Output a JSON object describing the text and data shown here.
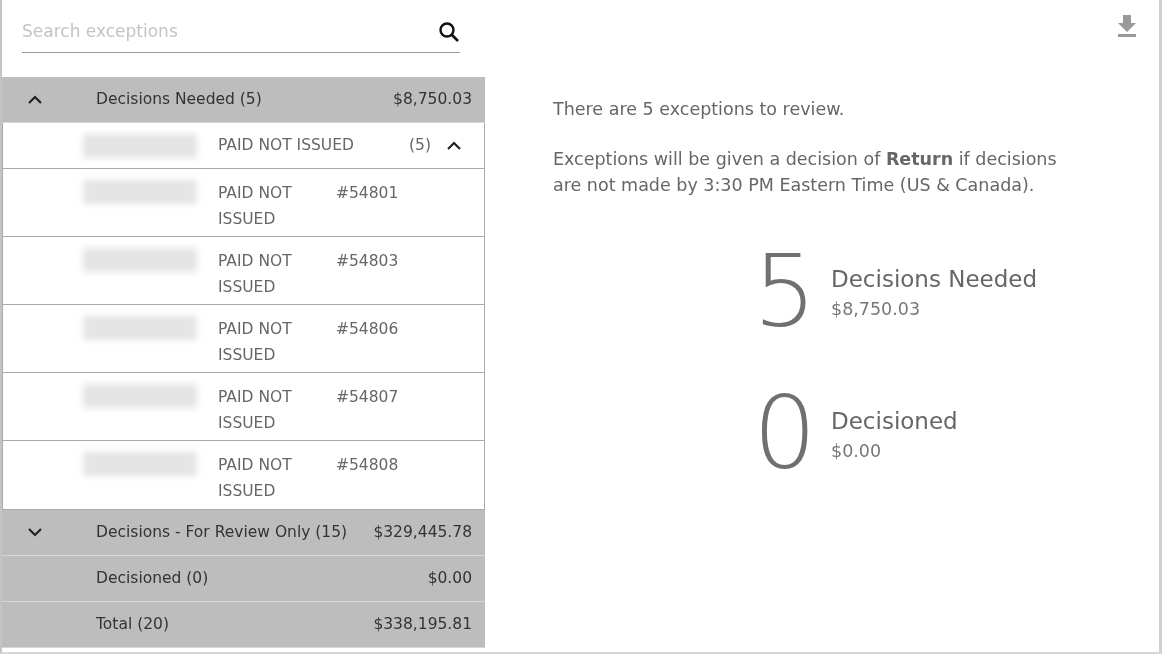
{
  "search": {
    "placeholder": "Search exceptions"
  },
  "groups": [
    {
      "label": "Decisions Needed (5)",
      "amount": "$8,750.03",
      "expanded": true,
      "subgroups": [
        {
          "label": "PAID NOT ISSUED",
          "count": "(5)",
          "expanded": true,
          "items": [
            {
              "type": "PAID NOT ISSUED",
              "number": "#54801"
            },
            {
              "type": "PAID NOT ISSUED",
              "number": "#54803"
            },
            {
              "type": "PAID NOT ISSUED",
              "number": "#54806"
            },
            {
              "type": "PAID NOT ISSUED",
              "number": "#54807"
            },
            {
              "type": "PAID NOT ISSUED",
              "number": "#54808"
            }
          ]
        }
      ]
    },
    {
      "label": "Decisions - For Review Only (15)",
      "amount": "$329,445.78",
      "expanded": false
    },
    {
      "label": "Decisioned (0)",
      "amount": "$0.00"
    },
    {
      "label": "Total (20)",
      "amount": "$338,195.81"
    }
  ],
  "summary": {
    "intro": "There are 5 exceptions to review.",
    "notice": "Exceptions will be given a decision of **Return** if decisions are not made by 3:30 PM Eastern Time (US & Canada).",
    "stats": [
      {
        "count": "5",
        "label": "Decisions Needed",
        "amount": "$8,750.03"
      },
      {
        "count": "0",
        "label": "Decisioned",
        "amount": "$0.00"
      }
    ]
  }
}
